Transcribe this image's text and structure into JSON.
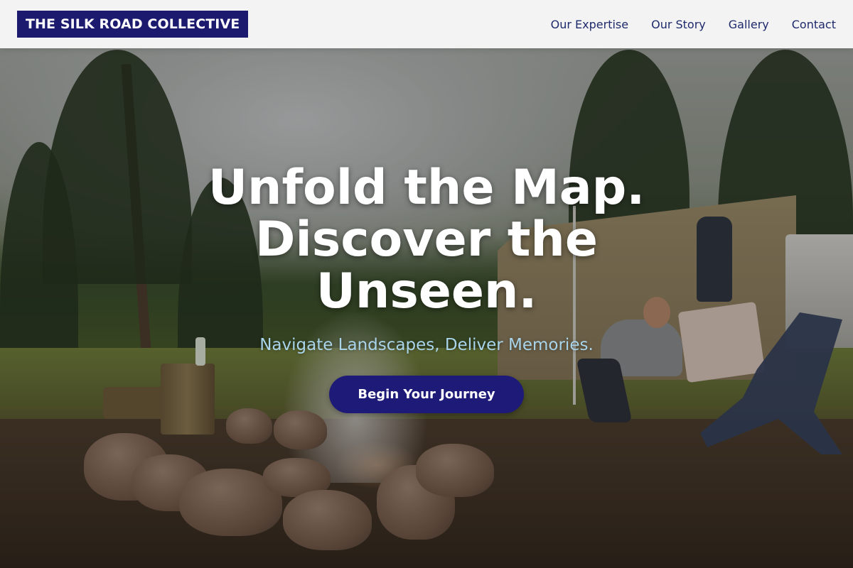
{
  "brand": {
    "name": "THE SILK ROAD COLLECTIVE"
  },
  "nav": {
    "items": [
      {
        "label": "Our Expertise"
      },
      {
        "label": "Our Story"
      },
      {
        "label": "Gallery"
      },
      {
        "label": "Contact"
      }
    ]
  },
  "hero": {
    "headline_line1": "Unfold the Map.",
    "headline_line2": "Discover the",
    "headline_line3": "Unseen.",
    "subheadline": "Navigate Landscapes, Deliver Memories.",
    "cta_label": "Begin Your Journey",
    "image_subject": "campsite-with-campfire-tent-and-person-in-forest"
  },
  "colors": {
    "brand_navy": "#1c1a6e",
    "nav_text": "#1e2a6b",
    "header_bg": "#f7f7f7",
    "subheadline": "#a9d4ea",
    "cta_bg": "#1e1b78",
    "headline": "#ffffff"
  }
}
